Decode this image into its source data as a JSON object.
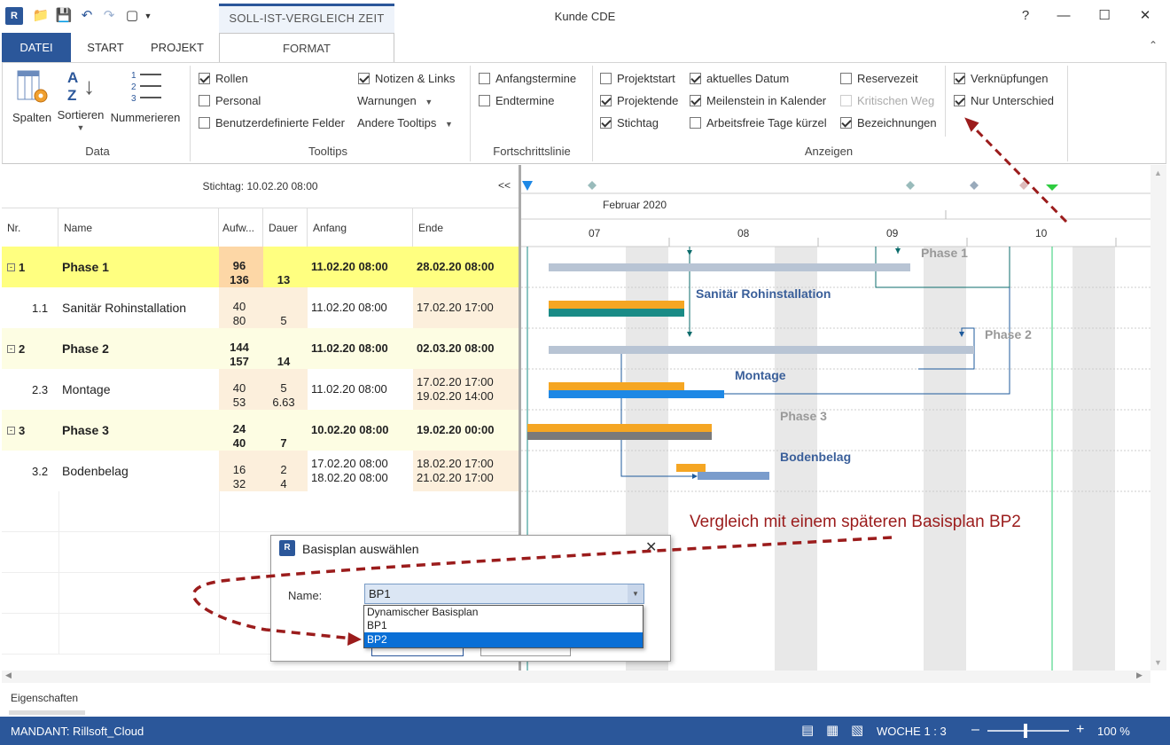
{
  "window": {
    "title": "Kunde CDE",
    "context_tab": "SOLL-IST-VERGLEICH ZEIT"
  },
  "tabs": [
    "DATEI",
    "START",
    "PROJEKT",
    "FORMAT"
  ],
  "ribbon": {
    "data_group": {
      "label": "Data",
      "buttons": [
        "Spalten",
        "Sortieren",
        "Nummerieren"
      ]
    },
    "tooltips_group": {
      "label": "Tooltips",
      "checks": [
        {
          "label": "Rollen",
          "checked": true
        },
        {
          "label": "Personal",
          "checked": false
        },
        {
          "label": "Benutzerdefinierte Felder",
          "checked": false
        },
        {
          "label": "Notizen & Links",
          "checked": true
        }
      ],
      "dropdowns": [
        "Warnungen",
        "Andere Tooltips"
      ]
    },
    "fortschritt_group": {
      "label": "Fortschrittslinie",
      "checks": [
        {
          "label": "Anfangstermine",
          "checked": false
        },
        {
          "label": "Endtermine",
          "checked": false
        }
      ]
    },
    "anzeigen_group": {
      "label": "Anzeigen",
      "checks": [
        {
          "label": "Projektstart",
          "checked": false
        },
        {
          "label": "Projektende",
          "checked": true
        },
        {
          "label": "Stichtag",
          "checked": true
        },
        {
          "label": "aktuelles Datum",
          "checked": true
        },
        {
          "label": "Meilenstein in Kalender",
          "checked": true
        },
        {
          "label": "Arbeitsfreie Tage kürzel",
          "checked": false
        },
        {
          "label": "Reservezeit",
          "checked": false
        },
        {
          "label": "Kritischen Weg",
          "checked": false,
          "disabled": true
        },
        {
          "label": "Bezeichnungen",
          "checked": true
        },
        {
          "label": "Verknüpfungen",
          "checked": true
        },
        {
          "label": "Nur Unterschied",
          "checked": true
        }
      ]
    }
  },
  "grid": {
    "stichtag": "Stichtag: 10.02.20 08:00",
    "collapse_label": "<<",
    "headers": [
      "Nr.",
      "Name",
      "Aufw...",
      "Dauer",
      "Anfang",
      "Ende"
    ],
    "rows": [
      {
        "nr": "1",
        "name": "Phase 1",
        "aufw1": "96",
        "aufw2": "136",
        "dauer1": "13",
        "dauer2": "",
        "anfang1": "11.02.20 08:00",
        "anfang2": "",
        "ende1": "28.02.20 08:00",
        "ende2": "",
        "level": "phase",
        "highlight": true
      },
      {
        "nr": "1.1",
        "name": "Sanitär Rohinstallation",
        "aufw1": "40",
        "aufw2": "80",
        "dauer1": "5",
        "dauer2": "",
        "anfang1": "11.02.20 08:00",
        "anfang2": "",
        "ende1": "17.02.20 17:00",
        "ende2": "",
        "level": "task"
      },
      {
        "nr": "2",
        "name": "Phase 2",
        "aufw1": "144",
        "aufw2": "157",
        "dauer1": "14",
        "dauer2": "",
        "anfang1": "11.02.20 08:00",
        "anfang2": "",
        "ende1": "02.03.20 08:00",
        "ende2": "",
        "level": "phase"
      },
      {
        "nr": "2.3",
        "name": "Montage",
        "aufw1": "40",
        "aufw2": "53",
        "dauer1": "5",
        "dauer2": "6.63",
        "anfang1": "11.02.20 08:00",
        "anfang2": "",
        "ende1": "17.02.20 17:00",
        "ende2": "19.02.20 14:00",
        "level": "task"
      },
      {
        "nr": "3",
        "name": "Phase 3",
        "aufw1": "24",
        "aufw2": "40",
        "dauer1": "7",
        "dauer2": "",
        "anfang1": "10.02.20 08:00",
        "anfang2": "",
        "ende1": "19.02.20 00:00",
        "ende2": "",
        "level": "phase"
      },
      {
        "nr": "3.2",
        "name": "Bodenbelag",
        "aufw1": "16",
        "aufw2": "32",
        "dauer1": "2",
        "dauer2": "4",
        "anfang1": "17.02.20 08:00",
        "anfang2": "18.02.20 08:00",
        "ende1": "18.02.20 17:00",
        "ende2": "21.02.20 17:00",
        "level": "task"
      }
    ]
  },
  "gantt": {
    "month": "Februar 2020",
    "weeks": [
      "07",
      "08",
      "09",
      "10"
    ],
    "labels": [
      "Phase 1",
      "Sanitär Rohinstallation",
      "Phase 2",
      "Montage",
      "Phase 3",
      "Bodenbelag"
    ],
    "annotation": "Vergleich mit einem späteren Basisplan BP2",
    "colors": {
      "orange": "#f5a623",
      "teal": "#1a8b86",
      "blue": "#1e88e5",
      "grayblue": "#b8c4d4",
      "gray": "#7a7a7a",
      "label_blue": "#3a5f9a",
      "label_gray": "#888888",
      "arrow": "#9b1c1c"
    }
  },
  "dialog": {
    "title": "Basisplan auswählen",
    "name_label": "Name:",
    "selected": "BP1",
    "options": [
      "Dynamischer Basisplan",
      "BP1",
      "BP2"
    ],
    "highlighted_option": "BP2"
  },
  "bottom": {
    "properties": "Eigenschaften"
  },
  "status": {
    "mandant": "MANDANT: Rillsoft_Cloud",
    "zoom_label": "WOCHE 1 : 3",
    "zoom_percent": "100 %"
  }
}
